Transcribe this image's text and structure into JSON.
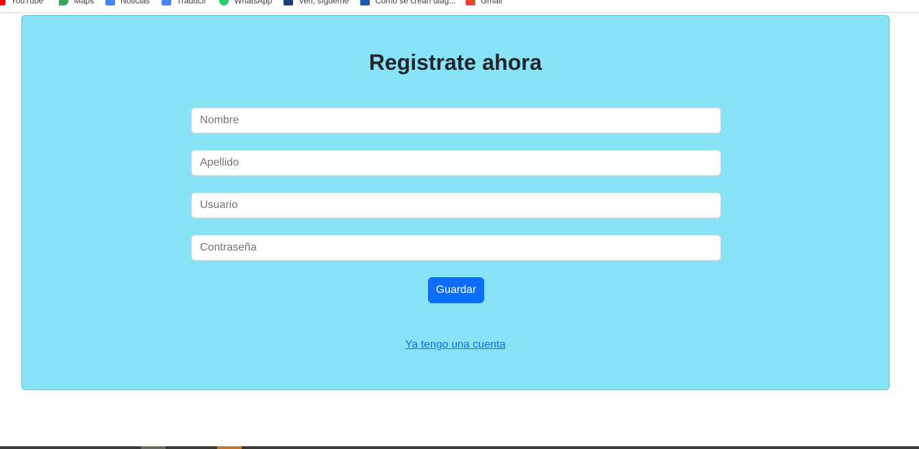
{
  "bookmarks": [
    {
      "label": "YouTube",
      "icon": "youtube-icon",
      "color": "#ff0000"
    },
    {
      "label": "Maps",
      "icon": "maps-icon",
      "color": "#34a853"
    },
    {
      "label": "Noticias",
      "icon": "news-icon",
      "color": "#4285f4"
    },
    {
      "label": "Traducir",
      "icon": "translate-icon",
      "color": "#4285f4"
    },
    {
      "label": "WhatsApp",
      "icon": "whatsapp-icon",
      "color": "#25d366"
    },
    {
      "label": "Ven, sígueme",
      "icon": "facebook-icon",
      "color": "#1b3f7a"
    },
    {
      "label": "Como se crean diag...",
      "icon": "facebook-icon",
      "color": "#1b5fb4"
    },
    {
      "label": "Gmail",
      "icon": "gmail-icon",
      "color": "#ea4335"
    }
  ],
  "form": {
    "title": "Registrate ahora",
    "fields": {
      "nombre": {
        "placeholder": "Nombre",
        "value": ""
      },
      "apellido": {
        "placeholder": "Apellido",
        "value": ""
      },
      "usuario": {
        "placeholder": "Usuario",
        "value": ""
      },
      "contrasena": {
        "placeholder": "Contraseña",
        "value": ""
      }
    },
    "submit_label": "Guardar",
    "login_link": "Ya tengo una cuenta"
  },
  "colors": {
    "card_background": "#87e3f5",
    "primary": "#0d6efd"
  }
}
